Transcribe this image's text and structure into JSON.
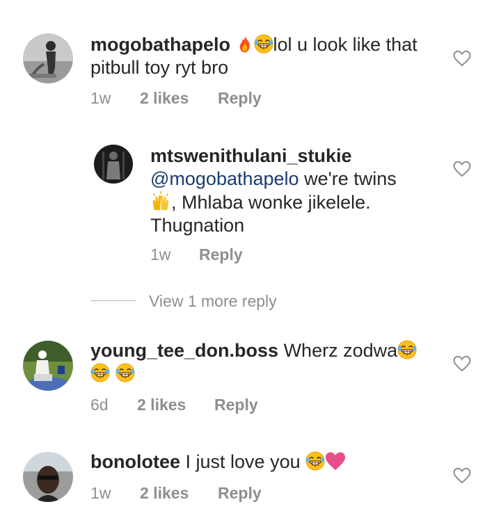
{
  "comments": [
    {
      "username": "mogobathapelo",
      "text": "lol u look like that pitbull toy ryt bro",
      "time": "1w",
      "likes": "2 likes",
      "reply": "Reply"
    },
    {
      "username": "mtswenithulani_stukie",
      "mention": "@mogobathapelo",
      "text_a": " we're twins",
      "text_b": ", Mhlaba wonke jikelele.",
      "text_c": "Thugnation",
      "time": "1w",
      "reply": "Reply"
    },
    {
      "username": "young_tee_don.boss",
      "text": "Wherz zodwa",
      "time": "6d",
      "likes": "2 likes",
      "reply": "Reply"
    },
    {
      "username": "bonolotee",
      "text": "I just love you",
      "time": "1w",
      "likes": "2 likes",
      "reply": "Reply"
    }
  ],
  "view_more": "View 1 more reply",
  "icons": {
    "heart": "heart-outline-icon",
    "fire": "fire-emoji",
    "laugh": "tears-of-joy-emoji",
    "raised_hands": "raised-hands-emoji",
    "pink_heart": "pink-heart-emoji"
  },
  "colors": {
    "text": "#262626",
    "meta": "#8e8e8e",
    "mention": "#1a3b6e",
    "pink_heart": "#e84e8a"
  }
}
